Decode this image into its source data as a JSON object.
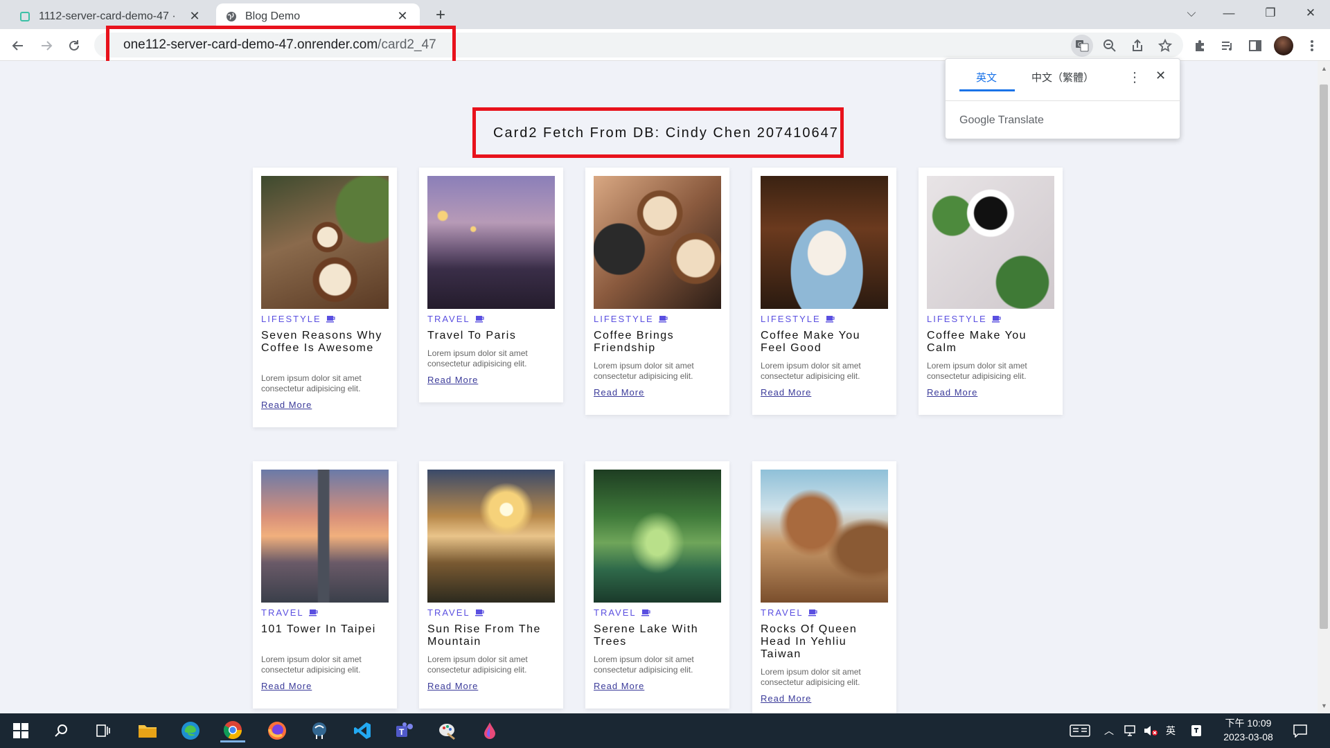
{
  "browser": {
    "tabs": [
      {
        "title": "1112-server-card-demo-47 ·",
        "favicon": "render-favicon-icon",
        "active": false
      },
      {
        "title": "Blog Demo",
        "favicon": "globe-icon",
        "active": true
      }
    ],
    "url_host": "one112-server-card-demo-47.onrender.com",
    "url_path": "/card2_47"
  },
  "translate_popup": {
    "source_lang": "英文",
    "target_lang": "中文（繁體）",
    "brand": "Google Translate"
  },
  "page": {
    "heading": "Card2 Fetch From DB: Cindy Chen 207410647",
    "cards": [
      {
        "category": "LIFESTYLE",
        "title": "Seven Reasons Why Coffee Is Awesome",
        "desc": "Lorem ipsum dolor sit amet consectetur adipisicing elit.",
        "link": "Read More",
        "image": "coffee-cups-latte-art"
      },
      {
        "category": "TRAVEL",
        "title": "Travel To Paris",
        "desc": "Lorem ipsum dolor sit amet consectetur adipisicing elit.",
        "link": "Read More",
        "image": "paris-bridge-dusk"
      },
      {
        "category": "LIFESTYLE",
        "title": "Coffee Brings Friendship",
        "desc": "Lorem ipsum dolor sit amet consectetur adipisicing elit.",
        "link": "Read More",
        "image": "hands-holding-coffee-cups"
      },
      {
        "category": "LIFESTYLE",
        "title": "Coffee Make You Feel Good",
        "desc": "Lorem ipsum dolor sit amet consectetur adipisicing elit.",
        "link": "Read More",
        "image": "coffee-cup-on-blue-saucer"
      },
      {
        "category": "LIFESTYLE",
        "title": "Coffee Make You Calm",
        "desc": "Lorem ipsum dolor sit amet consectetur adipisicing elit.",
        "link": "Read More",
        "image": "black-coffee-with-leaves"
      },
      {
        "category": "TRAVEL",
        "title": "101 Tower In Taipei",
        "desc": "Lorem ipsum dolor sit amet consectetur adipisicing elit.",
        "link": "Read More",
        "image": "taipei-101-skyline"
      },
      {
        "category": "TRAVEL",
        "title": "Sun Rise From The Mountain",
        "desc": "Lorem ipsum dolor sit amet consectetur adipisicing elit.",
        "link": "Read More",
        "image": "mountain-sunrise-clouds"
      },
      {
        "category": "TRAVEL",
        "title": "Serene Lake With Trees",
        "desc": "Lorem ipsum dolor sit amet consectetur adipisicing elit.",
        "link": "Read More",
        "image": "green-tree-tunnel-river"
      },
      {
        "category": "TRAVEL",
        "title": "Rocks Of Queen Head In Yehliu Taiwan",
        "desc": "Lorem ipsum dolor sit amet consectetur adipisicing elit.",
        "link": "Read More",
        "image": "yehliu-rock-formations"
      }
    ]
  },
  "taskbar": {
    "apps": [
      "windows-start-icon",
      "search-icon",
      "task-view-icon",
      "file-explorer-icon",
      "edge-icon",
      "chrome-icon",
      "firefox-icon",
      "postgresql-icon",
      "vscode-icon",
      "teams-icon",
      "paint-icon",
      "drop-icon"
    ],
    "ime": "英",
    "time": "下午 10:09",
    "date": "2023-03-08"
  }
}
